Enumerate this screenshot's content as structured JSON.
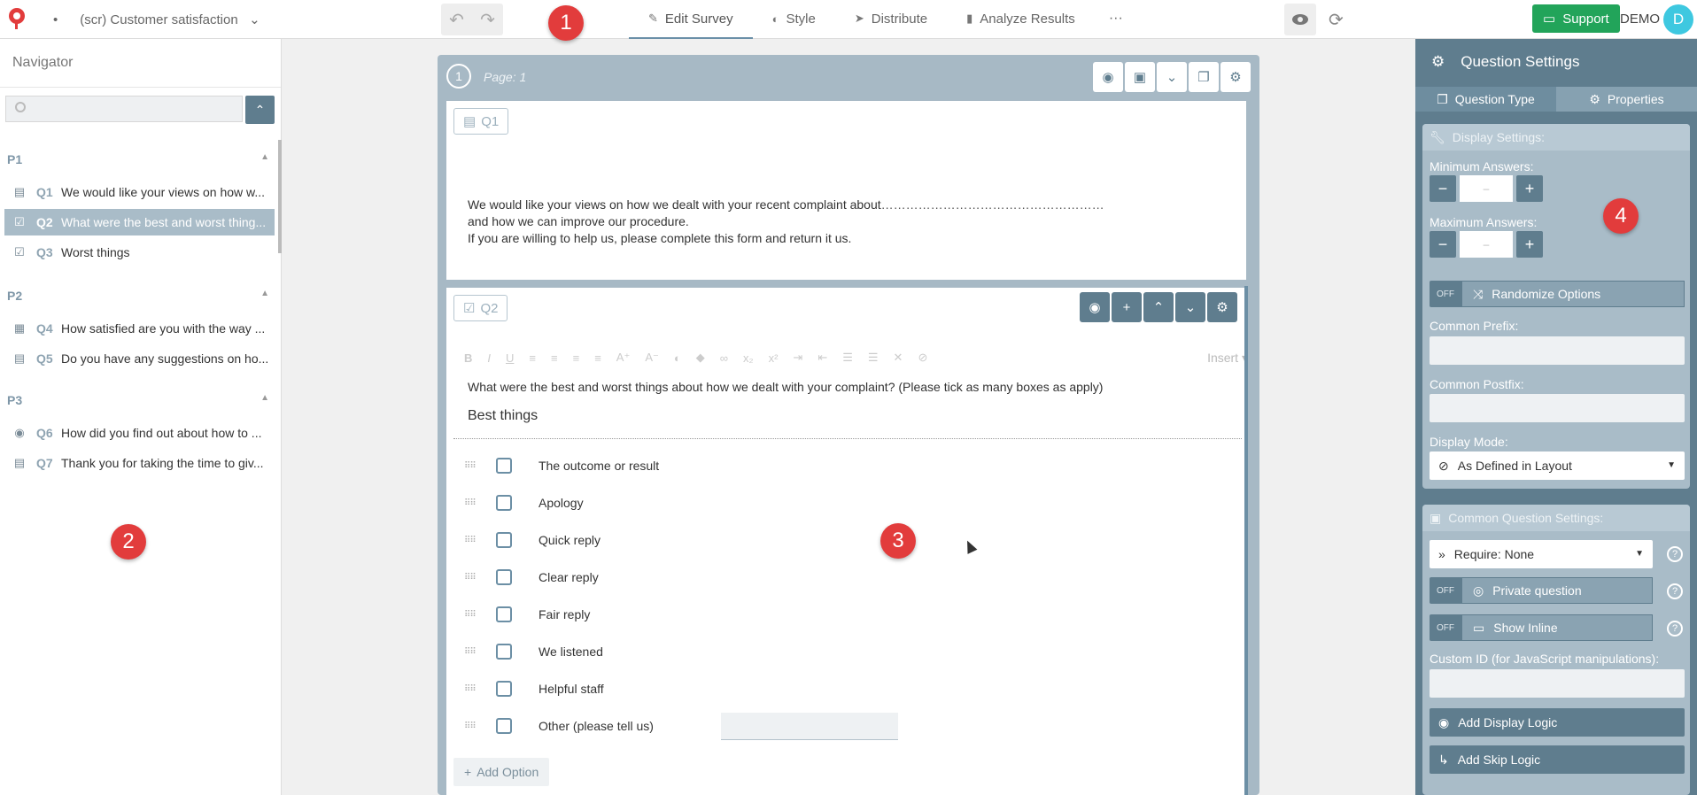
{
  "topbar": {
    "survey_dot": "•",
    "survey_name": "(scr) Customer satisfaction",
    "chevron": "⌄",
    "undo": "↶",
    "redo": "↷",
    "tabs": [
      {
        "label": "Edit Survey",
        "icon": "edit-icon"
      },
      {
        "label": "Style",
        "icon": "palette-icon"
      },
      {
        "label": "Distribute",
        "icon": "send-icon"
      },
      {
        "label": "Analyze Results",
        "icon": "bar-chart-icon"
      }
    ],
    "more": "···",
    "support_label": "Support",
    "demo_label": "DEMO",
    "avatar_letter": "D"
  },
  "badges": [
    "1",
    "2",
    "3",
    "4"
  ],
  "navigator": {
    "title": "Navigator",
    "search_placeholder": "",
    "pages": [
      {
        "label": "P1"
      },
      {
        "label": "P2"
      },
      {
        "label": "P3"
      }
    ],
    "items": [
      {
        "num": "Q1",
        "text": "We would like your views on how w...",
        "icon": "comment-icon"
      },
      {
        "num": "Q2",
        "text": "What were the best and worst thing...",
        "icon": "checkbox-icon"
      },
      {
        "num": "Q3",
        "text": "Worst things",
        "icon": "checkbox-icon"
      },
      {
        "num": "Q4",
        "text": "How satisfied are you with the way ...",
        "icon": "grid-icon"
      },
      {
        "num": "Q5",
        "text": "Do you have any suggestions on ho...",
        "icon": "text-icon"
      },
      {
        "num": "Q6",
        "text": "How did you find out about how to ...",
        "icon": "radio-icon"
      },
      {
        "num": "Q7",
        "text": "Thank you for taking the time to giv...",
        "icon": "comment-icon"
      }
    ]
  },
  "canvas": {
    "page_number": "1",
    "page_label": "Page: 1",
    "q1": {
      "tag": "Q1",
      "line1": "We would like your views on how we dealt with your recent complaint about",
      "dots": "………………………………………………",
      "line2": "and how we can improve our procedure.",
      "line3": "If you are willing to help us, please complete this form and return it us."
    },
    "q2": {
      "tag": "Q2",
      "toolbar_insert": "Insert",
      "text": "What were the best and worst things about how we dealt with your complaint? (Please tick as many boxes as apply)",
      "heading": "Best things",
      "options": [
        "The outcome or result",
        "Apology",
        "Quick reply",
        "Clear reply",
        "Fair reply",
        "We listened",
        "Helpful staff",
        "Other (please tell us)"
      ],
      "add_option": "Add Option"
    }
  },
  "settings": {
    "title": "Question Settings",
    "tab_type": "Question Type",
    "tab_props": "Properties",
    "display_header": "Display Settings:",
    "min_label": "Minimum Answers:",
    "max_label": "Maximum Answers:",
    "stepper_value": "–",
    "off": "OFF",
    "randomize": "Randomize Options",
    "prefix_label": "Common Prefix:",
    "postfix_label": "Common Postfix:",
    "display_mode_label": "Display Mode:",
    "display_mode_value": "As Defined in Layout",
    "common_header": "Common Question Settings:",
    "require_value": "Require: None",
    "private_label": "Private question",
    "inline_label": "Show Inline",
    "custom_id_label": "Custom ID (for JavaScript manipulations):",
    "display_logic": "Add Display Logic",
    "skip_logic": "Add Skip Logic",
    "help": "?"
  },
  "colors": {
    "accent": "#5f7d8e",
    "support_green": "#22a45a",
    "badge_red": "#e23c3c",
    "avatar": "#3ec8e0"
  }
}
